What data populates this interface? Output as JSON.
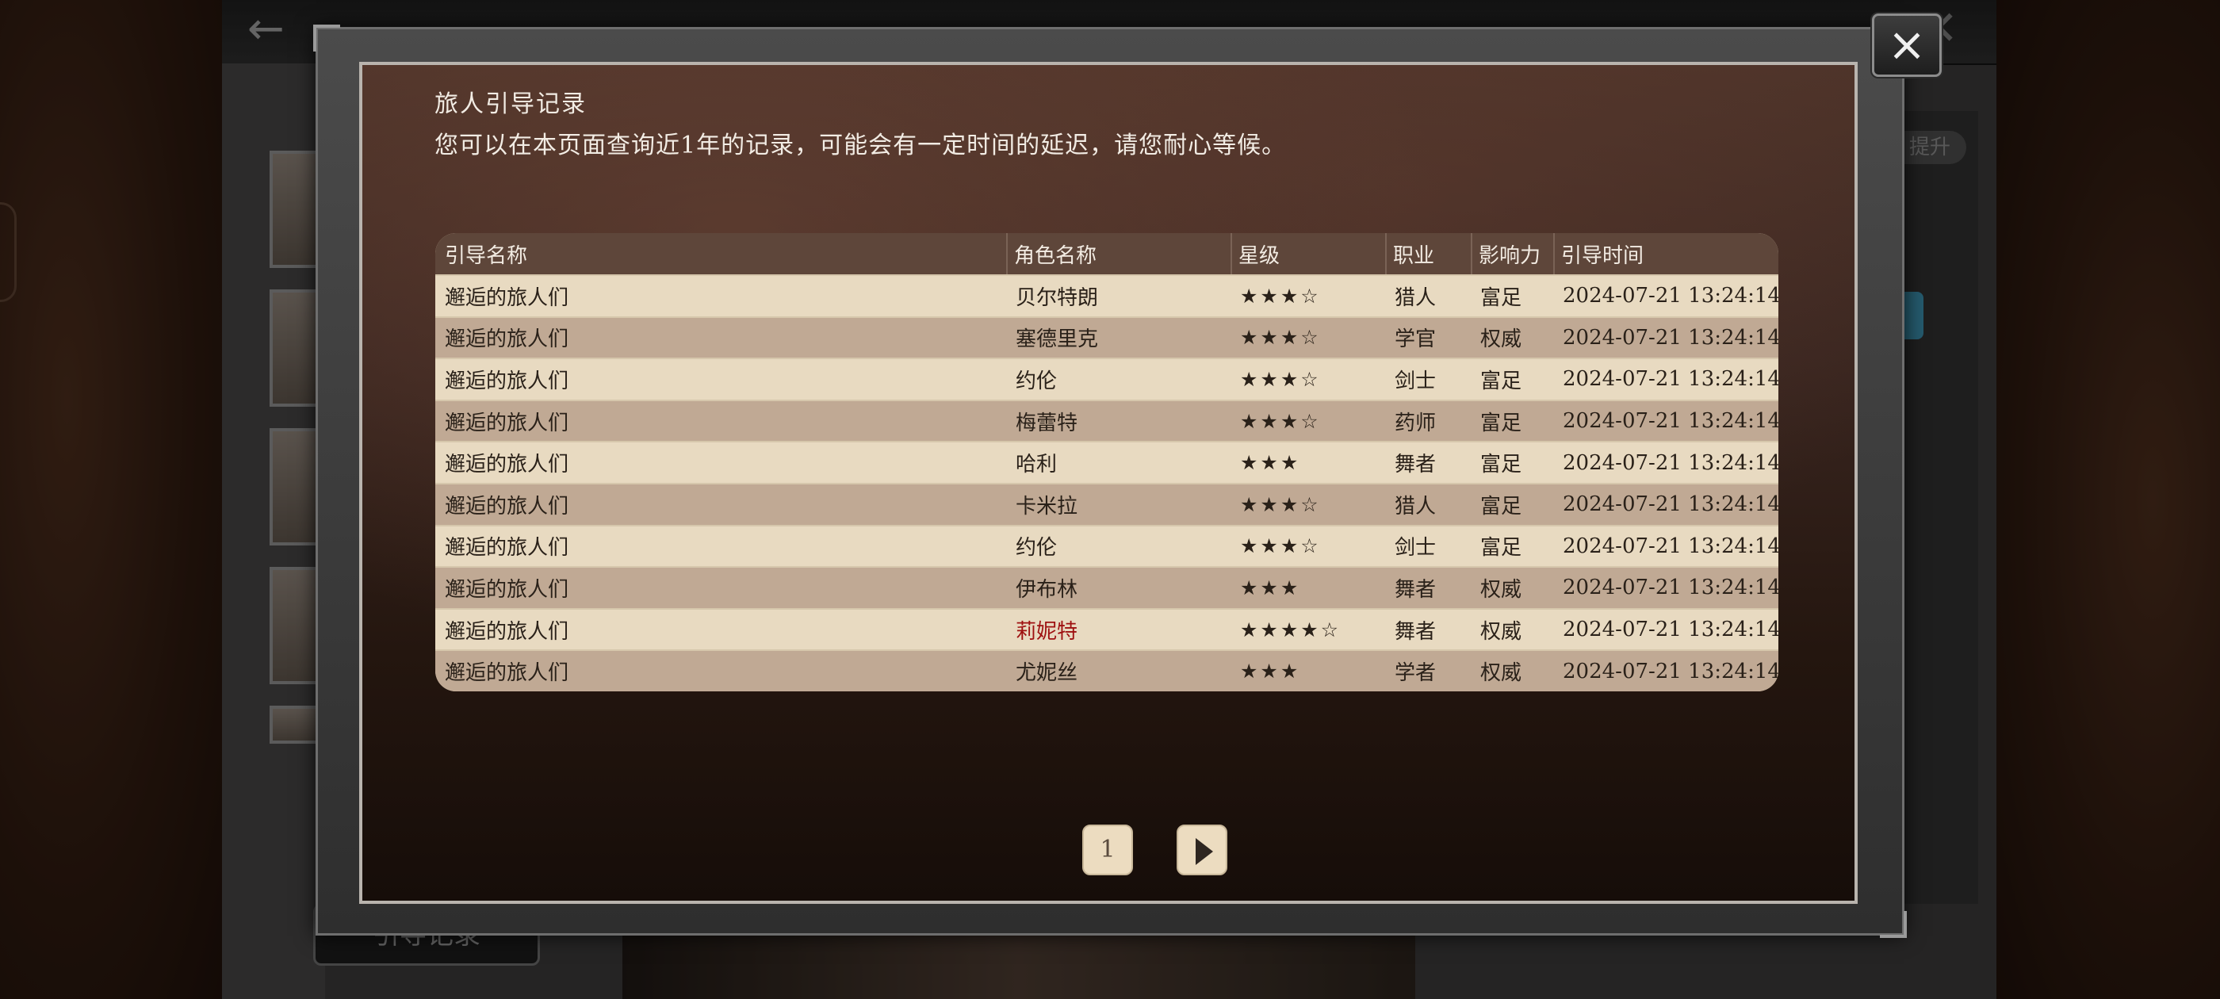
{
  "background": {
    "bottom_button_label": "引导记录",
    "right_pill_label": "提升"
  },
  "modal": {
    "title": "旅人引导记录",
    "subtitle": "您可以在本页面查询近1年的记录，可能会有一定时间的延迟，请您耐心等候。",
    "close_icon": "×",
    "table": {
      "columns": [
        "引导名称",
        "角色名称",
        "星级",
        "职业",
        "影响力",
        "引导时间"
      ],
      "rows": [
        {
          "guide": "邂逅的旅人们",
          "name": "贝尔特朗",
          "stars": "★★★☆",
          "job": "猎人",
          "influence": "富足",
          "time": "2024-07-21 13:24:14"
        },
        {
          "guide": "邂逅的旅人们",
          "name": "塞德里克",
          "stars": "★★★☆",
          "job": "学官",
          "influence": "权威",
          "time": "2024-07-21 13:24:14"
        },
        {
          "guide": "邂逅的旅人们",
          "name": "约伦",
          "stars": "★★★☆",
          "job": "剑士",
          "influence": "富足",
          "time": "2024-07-21 13:24:14"
        },
        {
          "guide": "邂逅的旅人们",
          "name": "梅蕾特",
          "stars": "★★★☆",
          "job": "药师",
          "influence": "富足",
          "time": "2024-07-21 13:24:14"
        },
        {
          "guide": "邂逅的旅人们",
          "name": "哈利",
          "stars": "★★★",
          "job": "舞者",
          "influence": "富足",
          "time": "2024-07-21 13:24:14"
        },
        {
          "guide": "邂逅的旅人们",
          "name": "卡米拉",
          "stars": "★★★☆",
          "job": "猎人",
          "influence": "富足",
          "time": "2024-07-21 13:24:14"
        },
        {
          "guide": "邂逅的旅人们",
          "name": "约伦",
          "stars": "★★★☆",
          "job": "剑士",
          "influence": "富足",
          "time": "2024-07-21 13:24:14"
        },
        {
          "guide": "邂逅的旅人们",
          "name": "伊布林",
          "stars": "★★★",
          "job": "舞者",
          "influence": "权威",
          "time": "2024-07-21 13:24:14"
        },
        {
          "guide": "邂逅的旅人们",
          "name": "莉妮特",
          "stars": "★★★★☆",
          "job": "舞者",
          "influence": "权威",
          "time": "2024-07-21 13:24:14",
          "highlight_color": "#9e1010"
        },
        {
          "guide": "邂逅的旅人们",
          "name": "尤妮丝",
          "stars": "★★★",
          "job": "学者",
          "influence": "权威",
          "time": "2024-07-21 13:24:14"
        }
      ]
    },
    "pagination": {
      "current_page": "1",
      "next_icon": "play-triangle-icon"
    }
  }
}
